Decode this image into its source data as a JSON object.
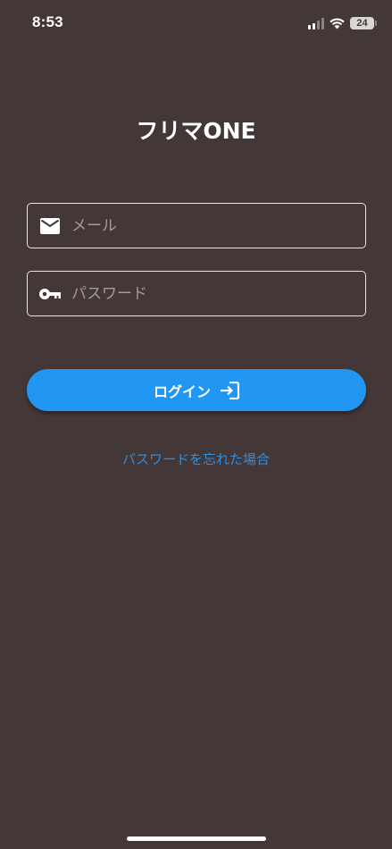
{
  "status_bar": {
    "time": "8:53",
    "battery_level": "24",
    "signal_bars_filled": 2,
    "signal_bars_total": 4
  },
  "app": {
    "title": "フリマONE"
  },
  "form": {
    "email": {
      "placeholder": "メール",
      "value": "",
      "icon": "mail-icon"
    },
    "password": {
      "placeholder": "パスワード",
      "value": "",
      "icon": "key-icon"
    },
    "login_label": "ログイン",
    "login_icon": "login-icon",
    "forgot_label": "パスワードを忘れた場合"
  },
  "colors": {
    "background": "#433737",
    "primary": "#2196f3",
    "link": "#2f8fe0",
    "text": "#ffffff",
    "placeholder": "#a49b9b"
  }
}
